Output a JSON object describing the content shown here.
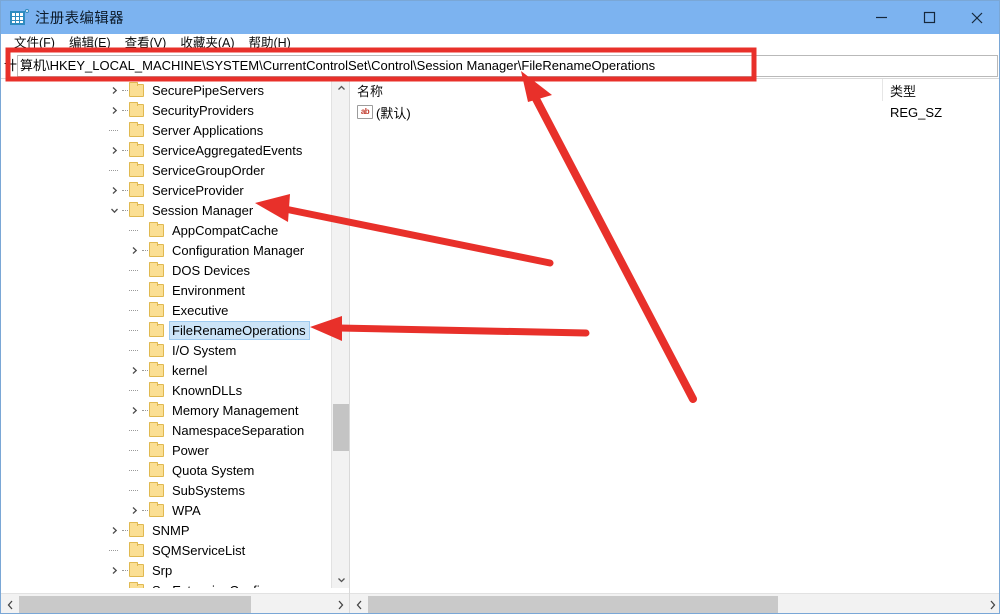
{
  "window": {
    "title": "注册表编辑器",
    "icon": "registry-editor-icon",
    "controls": {
      "minimize": "—",
      "maximize": "□",
      "close": "✕"
    },
    "titlebar_color": "#7cb3f0"
  },
  "menubar": {
    "items": [
      {
        "label": "文件(F)"
      },
      {
        "label": "编辑(E)"
      },
      {
        "label": "查看(V)"
      },
      {
        "label": "收藏夹(A)"
      },
      {
        "label": "帮助(H)"
      }
    ]
  },
  "address": {
    "prefix": "计",
    "value": "算机\\HKEY_LOCAL_MACHINE\\SYSTEM\\CurrentControlSet\\Control\\Session Manager\\FileRenameOperations",
    "full_path": "计算机\\HKEY_LOCAL_MACHINE\\SYSTEM\\CurrentControlSet\\Control\\Session Manager\\FileRenameOperations"
  },
  "tree": {
    "rows": [
      {
        "label": "SecurePipeServers",
        "depth": 1,
        "twisty": "collapsed",
        "selected": false
      },
      {
        "label": "SecurityProviders",
        "depth": 1,
        "twisty": "collapsed",
        "selected": false
      },
      {
        "label": "Server Applications",
        "depth": 1,
        "twisty": "none",
        "selected": false
      },
      {
        "label": "ServiceAggregatedEvents",
        "depth": 1,
        "twisty": "collapsed",
        "selected": false
      },
      {
        "label": "ServiceGroupOrder",
        "depth": 1,
        "twisty": "none",
        "selected": false
      },
      {
        "label": "ServiceProvider",
        "depth": 1,
        "twisty": "collapsed",
        "selected": false
      },
      {
        "label": "Session Manager",
        "depth": 1,
        "twisty": "expanded",
        "selected": false
      },
      {
        "label": "AppCompatCache",
        "depth": 2,
        "twisty": "none",
        "selected": false
      },
      {
        "label": "Configuration Manager",
        "depth": 2,
        "twisty": "collapsed",
        "selected": false
      },
      {
        "label": "DOS Devices",
        "depth": 2,
        "twisty": "none",
        "selected": false
      },
      {
        "label": "Environment",
        "depth": 2,
        "twisty": "none",
        "selected": false
      },
      {
        "label": "Executive",
        "depth": 2,
        "twisty": "none",
        "selected": false
      },
      {
        "label": "FileRenameOperations",
        "depth": 2,
        "twisty": "none",
        "selected": true
      },
      {
        "label": "I/O System",
        "depth": 2,
        "twisty": "none",
        "selected": false
      },
      {
        "label": "kernel",
        "depth": 2,
        "twisty": "collapsed",
        "selected": false
      },
      {
        "label": "KnownDLLs",
        "depth": 2,
        "twisty": "none",
        "selected": false
      },
      {
        "label": "Memory Management",
        "depth": 2,
        "twisty": "collapsed",
        "selected": false
      },
      {
        "label": "NamespaceSeparation",
        "depth": 2,
        "twisty": "none",
        "selected": false
      },
      {
        "label": "Power",
        "depth": 2,
        "twisty": "none",
        "selected": false
      },
      {
        "label": "Quota System",
        "depth": 2,
        "twisty": "none",
        "selected": false
      },
      {
        "label": "SubSystems",
        "depth": 2,
        "twisty": "none",
        "selected": false
      },
      {
        "label": "WPA",
        "depth": 2,
        "twisty": "collapsed",
        "selected": false
      },
      {
        "label": "SNMP",
        "depth": 1,
        "twisty": "collapsed",
        "selected": false
      },
      {
        "label": "SQMServiceList",
        "depth": 1,
        "twisty": "none",
        "selected": false
      },
      {
        "label": "Srp",
        "depth": 1,
        "twisty": "collapsed",
        "selected": false
      },
      {
        "label": "SrpExtensionConfig",
        "depth": 1,
        "twisty": "none",
        "selected": false
      }
    ]
  },
  "values_list": {
    "columns": [
      {
        "key": "name",
        "label": "名称"
      },
      {
        "key": "type",
        "label": "类型"
      }
    ],
    "rows": [
      {
        "icon": "string-value-icon",
        "icon_text": "ab",
        "name": "(默认)",
        "type": "REG_SZ"
      }
    ]
  },
  "annotations": {
    "highlight_color": "#e8302a",
    "box": {
      "label": "address-bar-highlight"
    },
    "arrows": [
      {
        "label": "arrow-to-address-bar",
        "target": "address-bar"
      },
      {
        "label": "arrow-to-session-manager",
        "target": "Session Manager"
      },
      {
        "label": "arrow-to-filerenameoperations",
        "target": "FileRenameOperations"
      }
    ]
  }
}
